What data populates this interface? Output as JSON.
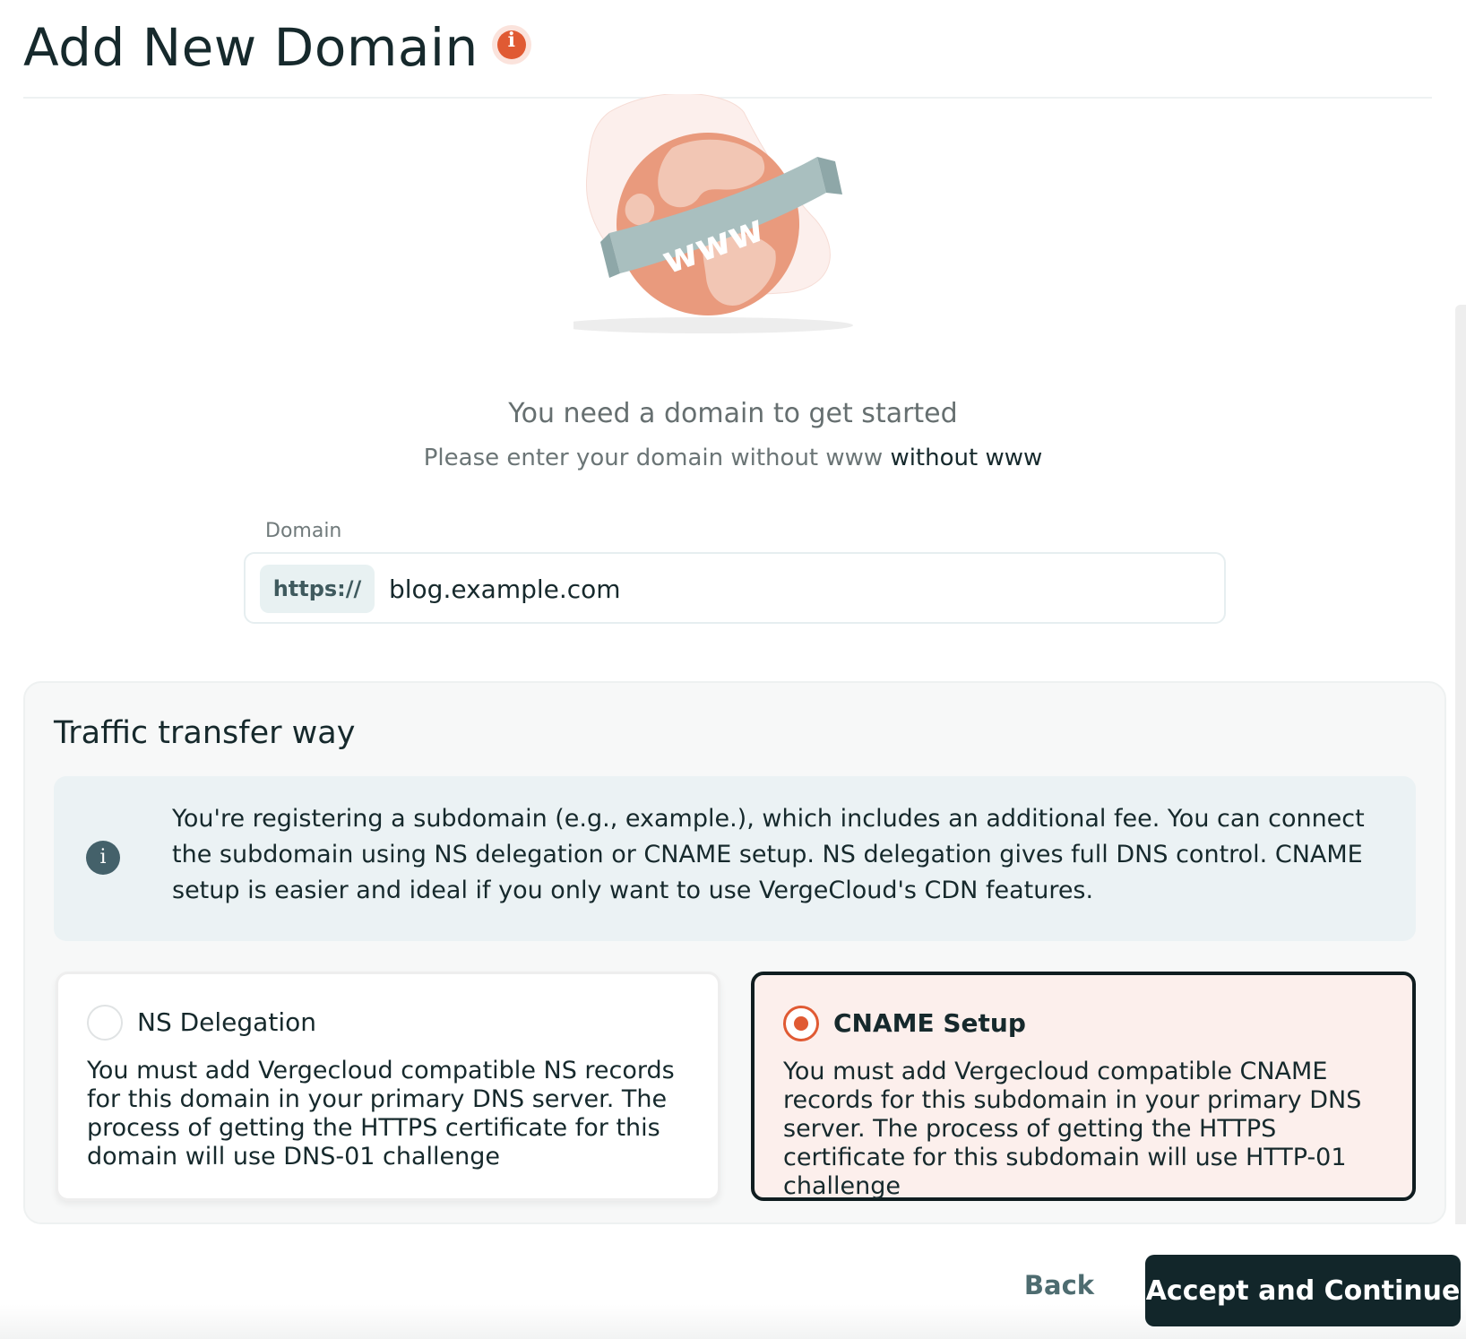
{
  "header": {
    "title": "Add New Domain",
    "info_icon": "info-icon"
  },
  "hero": {
    "illustration": "globe-www-icon",
    "title": "You need a domain to get started",
    "subtitle_plain": "Please enter your domain without www",
    "subtitle_emphasis": "without www"
  },
  "domain_field": {
    "label": "Domain",
    "prefix": "https://",
    "value": "blog.example.com"
  },
  "traffic": {
    "title": "Traffic transfer way",
    "info_icon": "info-icon",
    "info_text": "You're registering a subdomain (e.g., example.), which includes an additional fee. You can connect the subdomain using NS delegation or CNAME setup. NS delegation gives full DNS control. CNAME setup is easier and ideal if you only want to use VergeCloud's CDN features.",
    "options": [
      {
        "title": "NS Delegation",
        "description": "You must add Vergecloud compatible NS records for this domain in your primary DNS server. The process of getting the HTTPS certificate for this domain will use DNS-01 challenge",
        "selected": false
      },
      {
        "title": "CNAME Setup",
        "description": "You must add Vergecloud compatible CNAME records for this subdomain in your primary DNS server. The process of getting the HTTPS certificate for this subdomain will use HTTP-01 challenge",
        "selected": true
      }
    ]
  },
  "footer": {
    "back_label": "Back",
    "accept_label": "Accept and Continue"
  },
  "colors": {
    "accent": "#e05a33",
    "primary_dark": "#12262a",
    "info_bg": "#ebf2f4",
    "selected_bg": "#fcefec"
  }
}
